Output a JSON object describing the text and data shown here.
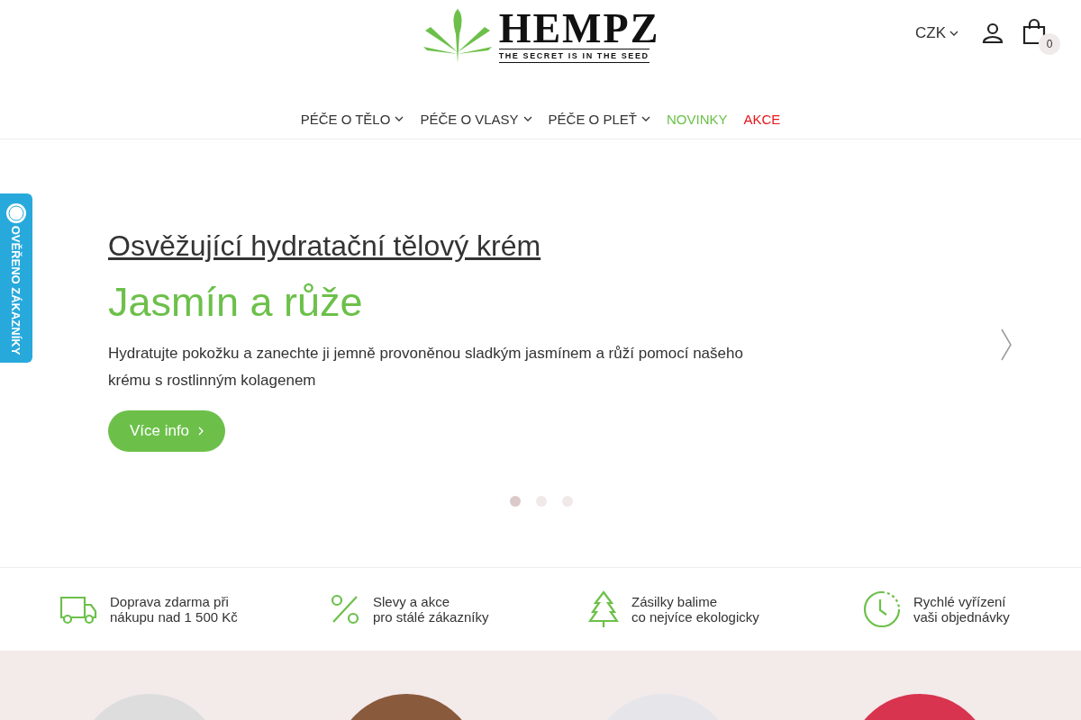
{
  "logo": {
    "name": "HEMPZ",
    "tagline": "THE SECRET IS IN THE SEED"
  },
  "header": {
    "currency": "CZK",
    "cart_count": "0"
  },
  "nav": [
    {
      "label": "PÉČE O TĚLO",
      "kind": "dropdown",
      "color": "#333333"
    },
    {
      "label": "PÉČE O VLASY",
      "kind": "dropdown",
      "color": "#333333"
    },
    {
      "label": "PÉČE O PLEŤ",
      "kind": "dropdown",
      "color": "#333333"
    },
    {
      "label": "NOVINKY",
      "kind": "link",
      "color": "#6cc04a"
    },
    {
      "label": "AKCE",
      "kind": "link",
      "color": "#e8161b"
    }
  ],
  "badge": {
    "label": "OVĚŘENO ZÁKAZNÍKY"
  },
  "hero": {
    "subtitle": "Osvěžující hydratační tělový krém",
    "title": "Jasmín a růže",
    "text": "Hydratujte pokožku a zanechte ji jemně provoněnou sladkým jasmínem a růží pomocí našeho krému s rostlinným kolagenem",
    "button": "Více info"
  },
  "dots": [
    {
      "selected": true
    },
    {
      "selected": false
    },
    {
      "selected": false
    }
  ],
  "features": [
    {
      "kind": "truck",
      "lines": [
        "Doprava zdarma při",
        "nákupu nad 1 500 Kč"
      ]
    },
    {
      "kind": "percent",
      "lines": [
        "Slevy a akce",
        "pro stálé zákazníky"
      ]
    },
    {
      "kind": "tree",
      "lines": [
        "Zásilky balime",
        "co nejvíce ekologicky"
      ]
    },
    {
      "kind": "clock",
      "lines": [
        "Rychlé vyřízení",
        "vaši objednávky"
      ]
    }
  ],
  "categories": [
    {
      "kind": "photo"
    },
    {
      "kind": "photo"
    },
    {
      "kind": "photo"
    },
    {
      "kind": "photo"
    }
  ]
}
